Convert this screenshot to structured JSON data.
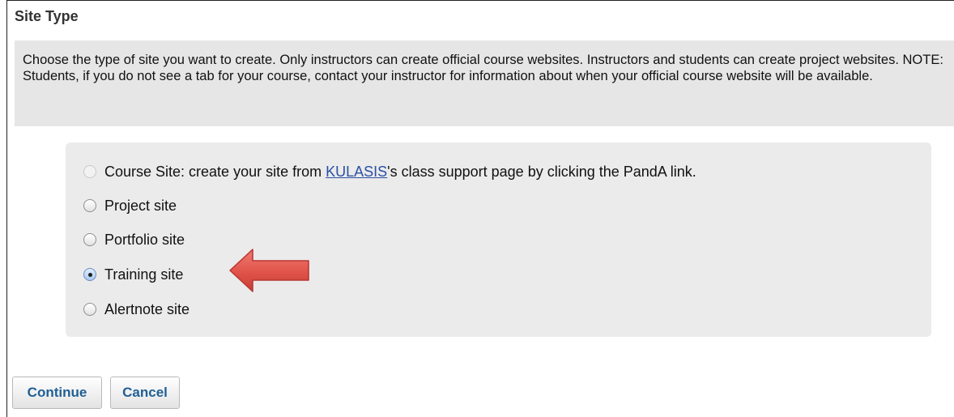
{
  "site_type": {
    "title": "Site Type",
    "instructions": "Choose the type of site you want to create. Only instructors can create official course websites. Instructors and students can create project websites. NOTE: Students, if you do not see a tab for your course, contact your instructor for information about when your official course website will be available.",
    "course_option": {
      "prefix": "Course Site: create your site from ",
      "link": "KULASIS",
      "suffix": "'s class support page by clicking the PandA link."
    },
    "options": [
      {
        "label": "Project site",
        "checked": false
      },
      {
        "label": "Portfolio site",
        "checked": false
      },
      {
        "label": "Training site",
        "checked": true
      },
      {
        "label": "Alertnote site",
        "checked": false
      }
    ],
    "selected": "Training site"
  },
  "buttons": {
    "continue": "Continue",
    "cancel": "Cancel"
  },
  "colors": {
    "panel_bg": "#ebebeb",
    "instructions_bg": "#e6e6e6",
    "button_text": "#1f5f95",
    "link": "#2a4fa5",
    "arrow": "#e0534a"
  },
  "icons": [
    "arrow-pointer-icon"
  ]
}
